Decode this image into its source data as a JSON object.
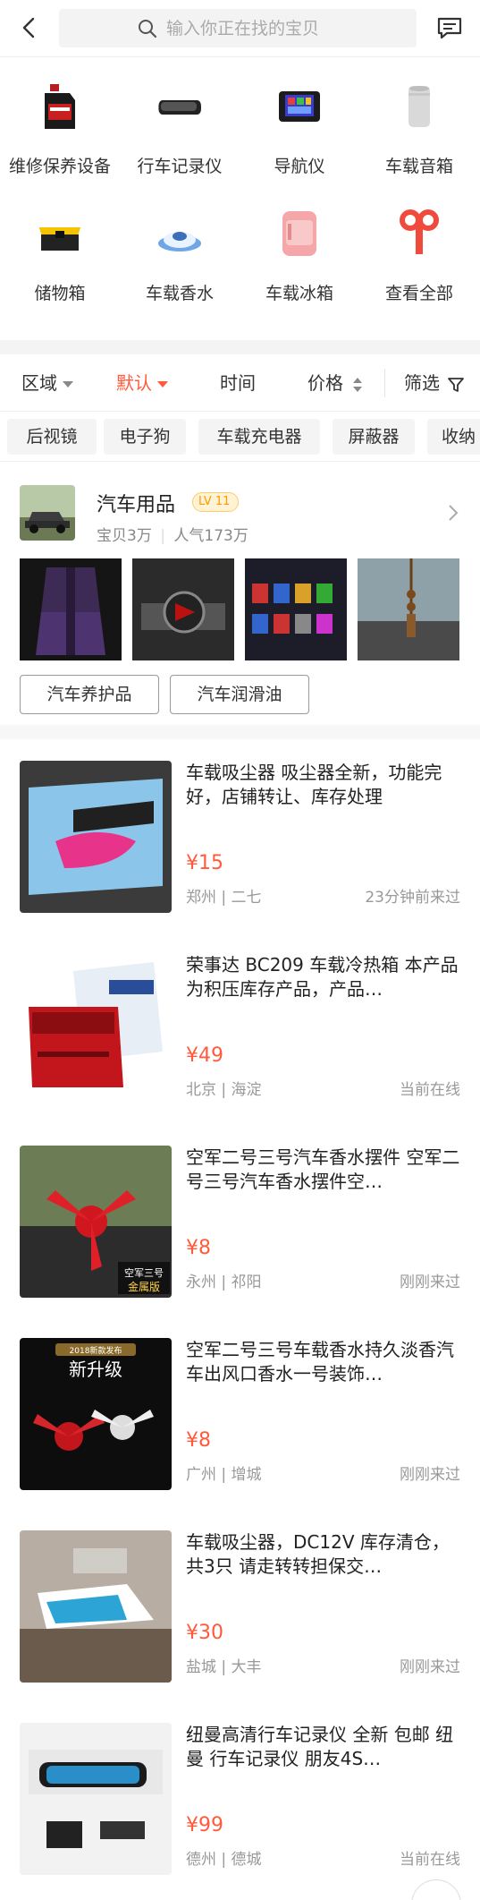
{
  "header": {
    "search_placeholder": "输入你正在找的宝贝",
    "back_icon": "back-arrow-icon",
    "search_icon": "search-icon",
    "message_icon": "message-icon"
  },
  "categories": [
    {
      "label": "维修保养设备",
      "icon": "engine-oil-icon"
    },
    {
      "label": "行车记录仪",
      "icon": "dashcam-icon"
    },
    {
      "label": "导航仪",
      "icon": "navigator-icon"
    },
    {
      "label": "车载音箱",
      "icon": "speaker-icon"
    },
    {
      "label": "储物箱",
      "icon": "storage-box-icon"
    },
    {
      "label": "车载香水",
      "icon": "perfume-icon"
    },
    {
      "label": "车载冰箱",
      "icon": "fridge-icon"
    },
    {
      "label": "查看全部",
      "icon": "view-all-icon"
    }
  ],
  "filters": {
    "region": "区域",
    "default": "默认",
    "time": "时间",
    "price": "价格",
    "filter": "筛选"
  },
  "tags": [
    "后视镜",
    "电子狗",
    "车载充电器",
    "屏蔽器",
    "收纳"
  ],
  "shop": {
    "name": "汽车用品",
    "level": "11",
    "items": "宝贝3万",
    "popularity": "人气173万",
    "tags": [
      "汽车养护品",
      "汽车润滑油"
    ]
  },
  "listings": [
    {
      "title": "车载吸尘器 吸尘器全新，功能完好，店铺转让、库存处理",
      "price": "¥15",
      "city": "郑州",
      "district": "二七",
      "when": "23分钟前来过"
    },
    {
      "title": "荣事达 BC209 车载冷热箱 本产品为积压库存产品，产品…",
      "price": "¥49",
      "city": "北京",
      "district": "海淀",
      "when": "当前在线"
    },
    {
      "title": "空军二号三号汽车香水摆件 空军二号三号汽车香水摆件空…",
      "price": "¥8",
      "city": "永州",
      "district": "祁阳",
      "when": "刚刚来过"
    },
    {
      "title": "空军二号三号车载香水持久淡香汽车出风口香水一号装饰…",
      "price": "¥8",
      "city": "广州",
      "district": "增城",
      "when": "刚刚来过"
    },
    {
      "title": "车载吸尘器，DC12V 库存清仓，共3只 请走转转担保交…",
      "price": "¥30",
      "city": "盐城",
      "district": "大丰",
      "when": "刚刚来过"
    },
    {
      "title": "纽曼高清行车记录仪  全新  包邮 纽曼 行车记录仪 朋友4S…",
      "price": "¥99",
      "city": "德州",
      "district": "德城",
      "when": "当前在线"
    }
  ],
  "image_text": {
    "img3_caption1": "空军三号",
    "img3_caption2": "金属版",
    "img4_badge": "2018新款发布",
    "img4_headline": "新升级"
  }
}
